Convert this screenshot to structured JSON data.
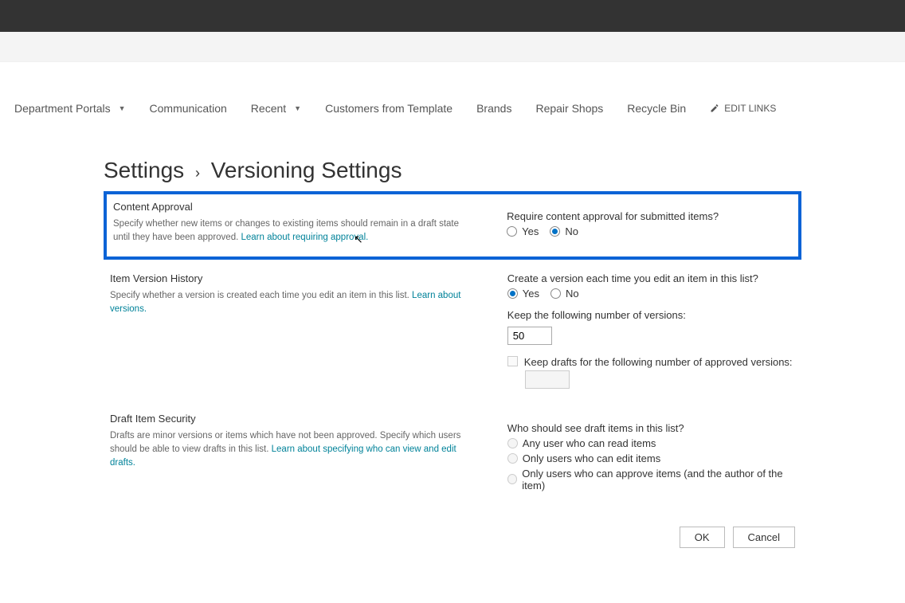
{
  "nav": {
    "items": [
      {
        "label": "Department Portals",
        "hasDropdown": true
      },
      {
        "label": "Communication",
        "hasDropdown": false
      },
      {
        "label": "Recent",
        "hasDropdown": true
      },
      {
        "label": "Customers from Template",
        "hasDropdown": false
      },
      {
        "label": "Brands",
        "hasDropdown": false
      },
      {
        "label": "Repair Shops",
        "hasDropdown": false
      },
      {
        "label": "Recycle Bin",
        "hasDropdown": false
      }
    ],
    "editLinks": "EDIT LINKS"
  },
  "breadcrumb": {
    "root": "Settings",
    "page": "Versioning Settings"
  },
  "sections": {
    "contentApproval": {
      "title": "Content Approval",
      "desc": "Specify whether new items or changes to existing items should remain in a draft state until they have been approved.  ",
      "learnLink": "Learn about requiring approval.",
      "question": "Require content approval for submitted items?",
      "optYes": "Yes",
      "optNo": "No"
    },
    "versionHistory": {
      "title": "Item Version History",
      "desc": "Specify whether a version is created each time you edit an item in this list.  ",
      "learnLink": "Learn about versions.",
      "q1": "Create a version each time you edit an item in this list?",
      "optYes": "Yes",
      "optNo": "No",
      "keepVersionsLabel": "Keep the following number of versions:",
      "keepVersionsValue": "50",
      "keepDraftsLabel": "Keep drafts for the following number of approved versions:",
      "keepDraftsValue": ""
    },
    "draftSecurity": {
      "title": "Draft Item Security",
      "desc": "Drafts are minor versions or items which have not been approved. Specify which users should be able to view drafts in this list.  ",
      "learnLink": "Learn about specifying who can view and edit drafts.",
      "question": "Who should see draft items in this list?",
      "opt1": "Any user who can read items",
      "opt2": "Only users who can edit items",
      "opt3": "Only users who can approve items (and the author of the item)"
    }
  },
  "buttons": {
    "ok": "OK",
    "cancel": "Cancel"
  }
}
